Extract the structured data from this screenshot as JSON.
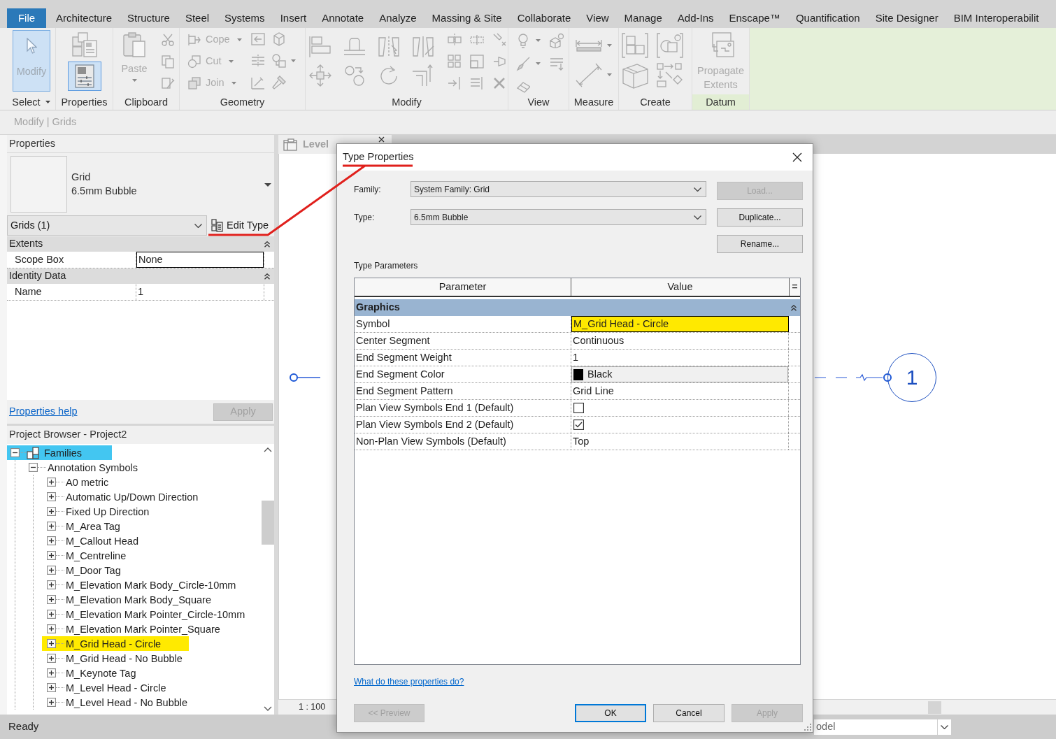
{
  "ribbon": {
    "tabs": [
      {
        "label": "File",
        "kind": "app_menu"
      },
      {
        "label": "Architecture",
        "kind": "tab"
      },
      {
        "label": "Structure",
        "kind": "tab"
      },
      {
        "label": "Steel",
        "kind": "tab"
      },
      {
        "label": "Systems",
        "kind": "tab"
      },
      {
        "label": "Insert",
        "kind": "tab"
      },
      {
        "label": "Annotate",
        "kind": "tab"
      },
      {
        "label": "Analyze",
        "kind": "tab"
      },
      {
        "label": "Massing & Site",
        "kind": "tab"
      },
      {
        "label": "Collaborate",
        "kind": "tab"
      },
      {
        "label": "View",
        "kind": "tab"
      },
      {
        "label": "Manage",
        "kind": "tab"
      },
      {
        "label": "Add-Ins",
        "kind": "tab"
      },
      {
        "label": "Enscape™",
        "kind": "tab"
      },
      {
        "label": "Quantification",
        "kind": "tab"
      },
      {
        "label": "Site Designer",
        "kind": "tab"
      },
      {
        "label": "BIM Interoperabilit",
        "kind": "tab"
      }
    ],
    "select_panel": {
      "label": "Select",
      "modify_tool": {
        "label": "Modify",
        "selected": true,
        "disabled": true
      }
    },
    "properties_panel": {
      "label": "Properties",
      "palette_toggle": {
        "selected": true
      }
    },
    "clipboard_panel": {
      "label": "Clipboard",
      "paste": {
        "label": "Paste",
        "disabled": true
      }
    },
    "geometry_panel": {
      "label": "Geometry",
      "tools": [
        {
          "label": "Cope",
          "disabled": true
        },
        {
          "label": "Cut",
          "disabled": true
        },
        {
          "label": "Join",
          "disabled": true
        }
      ]
    },
    "modify_panel": {
      "label": "Modify"
    },
    "view_panel": {
      "label": "View"
    },
    "measure_panel": {
      "label": "Measure"
    },
    "create_panel": {
      "label": "Create"
    },
    "datum_panel": {
      "label": "Datum",
      "propagate_extents": {
        "label": "Propagate Extents",
        "disabled": true
      }
    }
  },
  "options_bar": {
    "context": "Modify | Grids"
  },
  "properties": {
    "title": "Properties",
    "type_selector": {
      "family": "Grid",
      "type": "6.5mm Bubble"
    },
    "instance_filter": "Grids (1)",
    "edit_type": "Edit Type",
    "groups": [
      {
        "name": "Extents",
        "expanded": true,
        "rows": [
          {
            "name": "Scope Box",
            "value": "None",
            "focused": true
          }
        ]
      },
      {
        "name": "Identity Data",
        "expanded": true,
        "rows": [
          {
            "name": "Name",
            "value": "1",
            "focused": false
          }
        ]
      }
    ],
    "help_link": "Properties help",
    "apply": {
      "label": "Apply",
      "disabled": true
    }
  },
  "project_browser": {
    "title": "Project Browser - Project2",
    "tree": [
      {
        "label": "Families",
        "expanded": true,
        "highlighted": true,
        "children": [
          {
            "label": "Annotation Symbols",
            "expanded": true,
            "highlighted": false,
            "children": [
              {
                "label": "A0 metric",
                "expanded": false,
                "highlighted": false
              },
              {
                "label": "Automatic Up/Down Direction",
                "expanded": false,
                "highlighted": false
              },
              {
                "label": "Fixed Up Direction",
                "expanded": false,
                "highlighted": false
              },
              {
                "label": "M_Area Tag",
                "expanded": false,
                "highlighted": false
              },
              {
                "label": "M_Callout Head",
                "expanded": false,
                "highlighted": false
              },
              {
                "label": "M_Centreline",
                "expanded": false,
                "highlighted": false
              },
              {
                "label": "M_Door Tag",
                "expanded": false,
                "highlighted": false
              },
              {
                "label": "M_Elevation Mark Body_Circle-10mm",
                "expanded": false,
                "highlighted": false
              },
              {
                "label": "M_Elevation Mark Body_Square",
                "expanded": false,
                "highlighted": false
              },
              {
                "label": "M_Elevation Mark Pointer_Circle-10mm",
                "expanded": false,
                "highlighted": false
              },
              {
                "label": "M_Elevation Mark Pointer_Square",
                "expanded": false,
                "highlighted": false
              },
              {
                "label": "M_Grid Head - Circle",
                "expanded": false,
                "highlighted": true
              },
              {
                "label": "M_Grid Head - No Bubble",
                "expanded": false,
                "highlighted": false
              },
              {
                "label": "M_Keynote Tag",
                "expanded": false,
                "highlighted": false
              },
              {
                "label": "M_Level Head - Circle",
                "expanded": false,
                "highlighted": false
              },
              {
                "label": "M_Level Head - No Bubble",
                "expanded": false,
                "highlighted": false
              }
            ]
          }
        ]
      }
    ]
  },
  "view": {
    "tab": "Level",
    "scale": "1 : 100",
    "grid_head": "1"
  },
  "dialog": {
    "title": "Type Properties",
    "family": {
      "label": "Family:",
      "value": "System Family: Grid"
    },
    "type": {
      "label": "Type:",
      "value": "6.5mm Bubble"
    },
    "side_buttons": [
      {
        "label": "Load...",
        "disabled": true
      },
      {
        "label": "Duplicate...",
        "disabled": false
      },
      {
        "label": "Rename...",
        "disabled": false
      }
    ],
    "section_label": "Type Parameters",
    "table": {
      "columns": [
        "Parameter",
        "Value",
        "="
      ],
      "groups": [
        {
          "name": "Graphics",
          "expanded": true,
          "rows": [
            {
              "name": "Symbol",
              "kind": "text",
              "value": "M_Grid Head - Circle",
              "highlighted": true
            },
            {
              "name": "Center Segment",
              "kind": "text",
              "value": "Continuous",
              "highlighted": false
            },
            {
              "name": "End Segment Weight",
              "kind": "text",
              "value": "1",
              "highlighted": false
            },
            {
              "name": "End Segment Color",
              "kind": "color",
              "value": "Black",
              "color": "#000000",
              "highlighted": false
            },
            {
              "name": "End Segment Pattern",
              "kind": "text",
              "value": "Grid Line",
              "highlighted": false
            },
            {
              "name": "Plan View Symbols End 1 (Default)",
              "kind": "checkbox",
              "checked": false,
              "highlighted": false
            },
            {
              "name": "Plan View Symbols End 2 (Default)",
              "kind": "checkbox",
              "checked": true,
              "highlighted": false
            },
            {
              "name": "Non-Plan View Symbols (Default)",
              "kind": "text",
              "value": "Top",
              "highlighted": false
            }
          ]
        }
      ]
    },
    "help_link": "What do these properties do?",
    "buttons": [
      {
        "label": "<< Preview",
        "disabled": true,
        "default": false
      },
      {
        "label": "OK",
        "disabled": false,
        "default": true
      },
      {
        "label": "Cancel",
        "disabled": false,
        "default": false
      },
      {
        "label": "Apply",
        "disabled": true,
        "default": false
      }
    ]
  },
  "status_bar": {
    "message": "Ready",
    "model_field": "odel"
  }
}
